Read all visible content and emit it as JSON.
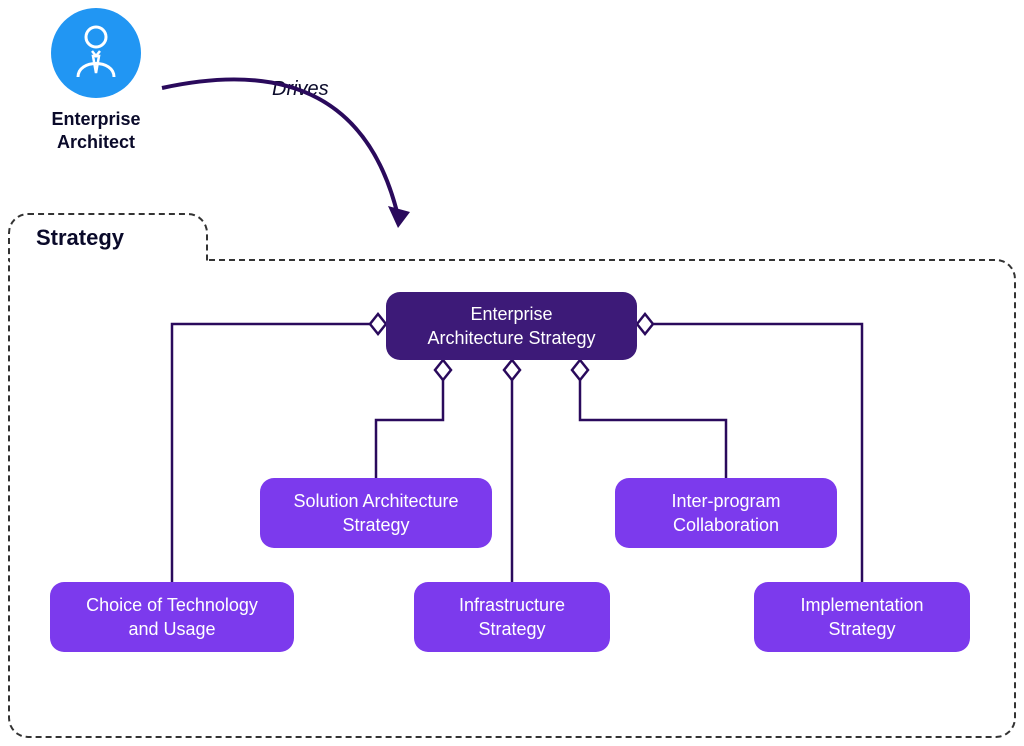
{
  "actor": {
    "label": "Enterprise\nArchitect"
  },
  "edge": {
    "label": "Drives"
  },
  "container": {
    "label": "Strategy"
  },
  "nodes": {
    "root": "Enterprise\nArchitecture Strategy",
    "choice": "Choice of Technology\nand Usage",
    "solution": "Solution Architecture\nStrategy",
    "infrastructure": "Infrastructure\nStrategy",
    "interprogram": "Inter-program\nCollaboration",
    "implementation": "Implementation\nStrategy"
  },
  "colors": {
    "actor_bg": "#2196F3",
    "root_bg": "#3d1a78",
    "child_bg": "#7c3aed",
    "line": "#2a0a5c"
  }
}
